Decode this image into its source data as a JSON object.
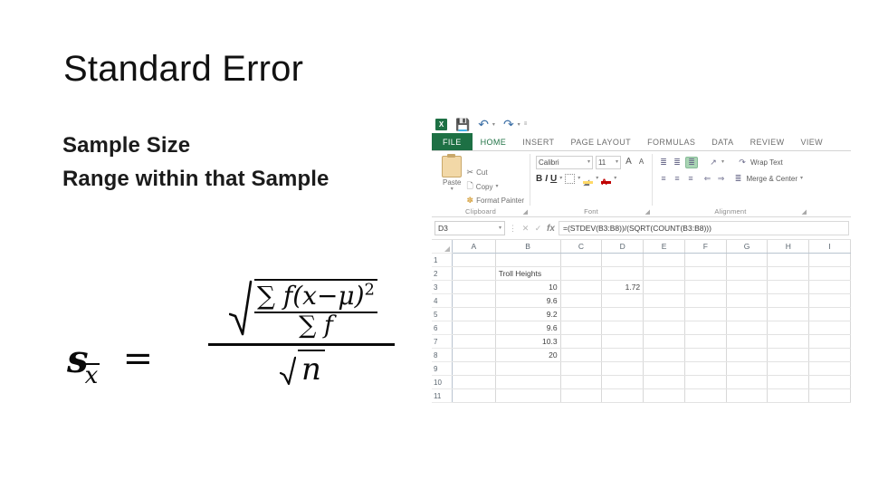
{
  "slide": {
    "title": "Standard Error",
    "bullets": [
      "Sample Size",
      "Range within that Sample"
    ]
  },
  "formula": {
    "lhs_symbol": "s",
    "lhs_subscript": "x",
    "equals": "=",
    "inner_numerator": "∑ f(x−μ)",
    "inner_numerator_exponent": "2",
    "inner_denominator": "∑ f",
    "outer_denominator": "n",
    "radical_label": "square-root",
    "plain_text": "s_xbar = sqrt( ∑ f(x−μ)^2 / ∑ f ) / sqrt(n)"
  },
  "excel": {
    "quick_access": {
      "app_icon": "excel-logo",
      "items": [
        "save-icon",
        "undo-icon",
        "redo-icon",
        "customize-icon"
      ],
      "app_letter": "X"
    },
    "tabs": [
      {
        "label": "FILE",
        "active": false,
        "file": true
      },
      {
        "label": "HOME",
        "active": true,
        "file": false
      },
      {
        "label": "INSERT",
        "active": false,
        "file": false
      },
      {
        "label": "PAGE LAYOUT",
        "active": false,
        "file": false
      },
      {
        "label": "FORMULAS",
        "active": false,
        "file": false
      },
      {
        "label": "DATA",
        "active": false,
        "file": false
      },
      {
        "label": "REVIEW",
        "active": false,
        "file": false
      },
      {
        "label": "VIEW",
        "active": false,
        "file": false
      }
    ],
    "ribbon": {
      "clipboard": {
        "group_label": "Clipboard",
        "paste_label": "Paste",
        "cut_label": "Cut",
        "copy_label": "Copy",
        "format_painter_label": "Format Painter",
        "cut_icon": "scissors-icon",
        "copy_icon": "copy-icon",
        "format_painter_icon": "paintbrush-icon"
      },
      "font": {
        "group_label": "Font",
        "font_name": "Calibri",
        "font_size": "11",
        "grow_font": "A",
        "shrink_font": "A",
        "bold": "B",
        "italic": "I",
        "underline": "U",
        "borders_icon": "borders-icon",
        "fill_color_icon": "fill-color-icon",
        "font_color_icon": "font-color-icon",
        "font_color_letter": "A"
      },
      "alignment": {
        "group_label": "Alignment",
        "wrap_text_label": "Wrap Text",
        "merge_center_label": "Merge & Center",
        "orientation_icon": "orientation-icon",
        "align_top_icon": "align-top-icon",
        "align_middle_icon": "align-middle-icon",
        "align_bottom_icon": "align-bottom-icon",
        "align_left_icon": "align-left-icon",
        "align_center_icon": "align-center-icon",
        "align_right_icon": "align-right-icon",
        "decrease_indent_icon": "decrease-indent-icon",
        "increase_indent_icon": "increase-indent-icon"
      }
    },
    "formula_bar": {
      "name_box": "D3",
      "cancel_icon": "cancel-icon",
      "enter_icon": "enter-icon",
      "function_icon": "fx-icon",
      "formula": "=(STDEV(B3:B8))/(SQRT(COUNT(B3:B8)))"
    },
    "sheet": {
      "columns": [
        "A",
        "B",
        "C",
        "D",
        "E",
        "F",
        "G",
        "H",
        "I"
      ],
      "rows": [
        "1",
        "2",
        "3",
        "4",
        "5",
        "6",
        "7",
        "8",
        "9",
        "10",
        "11"
      ],
      "cells": {
        "B2": "Troll Heights",
        "B3": "10",
        "B4": "9.6",
        "B5": "9.2",
        "B6": "9.6",
        "B7": "10.3",
        "B8": "20",
        "D3": "1.72"
      }
    }
  }
}
